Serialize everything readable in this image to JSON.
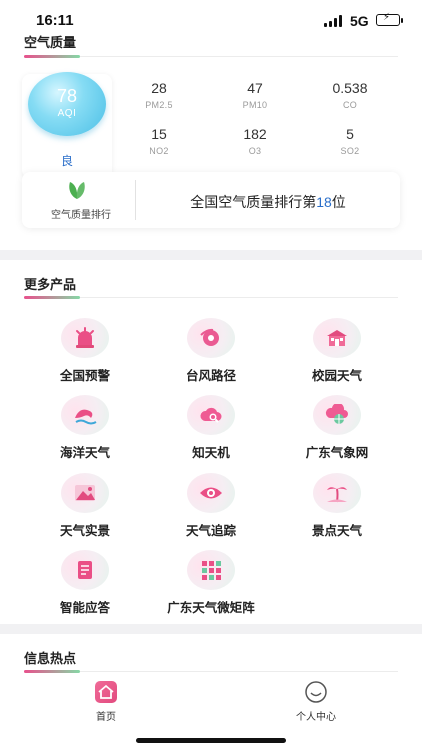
{
  "status_bar": {
    "time": "16:11",
    "network": "5G"
  },
  "air_quality": {
    "title": "空气质量",
    "aqi": {
      "value": "78",
      "unit": "AQI",
      "level": "良"
    },
    "pollutants": [
      {
        "value": "28",
        "label": "PM2.5"
      },
      {
        "value": "47",
        "label": "PM10"
      },
      {
        "value": "0.538",
        "label": "CO"
      },
      {
        "value": "15",
        "label": "NO2"
      },
      {
        "value": "182",
        "label": "O3"
      },
      {
        "value": "5",
        "label": "SO2"
      }
    ],
    "ranking": {
      "button_label": "空气质量排行",
      "text_prefix": "全国空气质量排行第",
      "rank": "18",
      "text_suffix": "位"
    }
  },
  "more_products": {
    "title": "更多产品",
    "items": [
      {
        "label": "全国预警",
        "icon": "alarm-icon"
      },
      {
        "label": "台风路径",
        "icon": "typhoon-icon"
      },
      {
        "label": "校园天气",
        "icon": "school-icon"
      },
      {
        "label": "海洋天气",
        "icon": "wave-icon"
      },
      {
        "label": "知天机",
        "icon": "cloud-search-icon"
      },
      {
        "label": "广东气象网",
        "icon": "cloud-globe-icon"
      },
      {
        "label": "天气实景",
        "icon": "landscape-icon"
      },
      {
        "label": "天气追踪",
        "icon": "eye-icon"
      },
      {
        "label": "景点天气",
        "icon": "palm-tree-icon"
      },
      {
        "label": "智能应答",
        "icon": "document-icon"
      },
      {
        "label": "广东天气微矩阵",
        "icon": "grid-icon"
      }
    ]
  },
  "info_hotspot": {
    "title": "信息热点"
  },
  "tab_bar": {
    "tabs": [
      {
        "label": "首页",
        "icon": "home-icon",
        "active": true
      },
      {
        "label": "个人中心",
        "icon": "smiley-icon",
        "active": false
      }
    ]
  },
  "colors": {
    "accent_pink": "#e8508c",
    "accent_green": "#86d8a6",
    "link_blue": "#2a6ec9",
    "aqi_bubble": "#4bbfe6"
  }
}
